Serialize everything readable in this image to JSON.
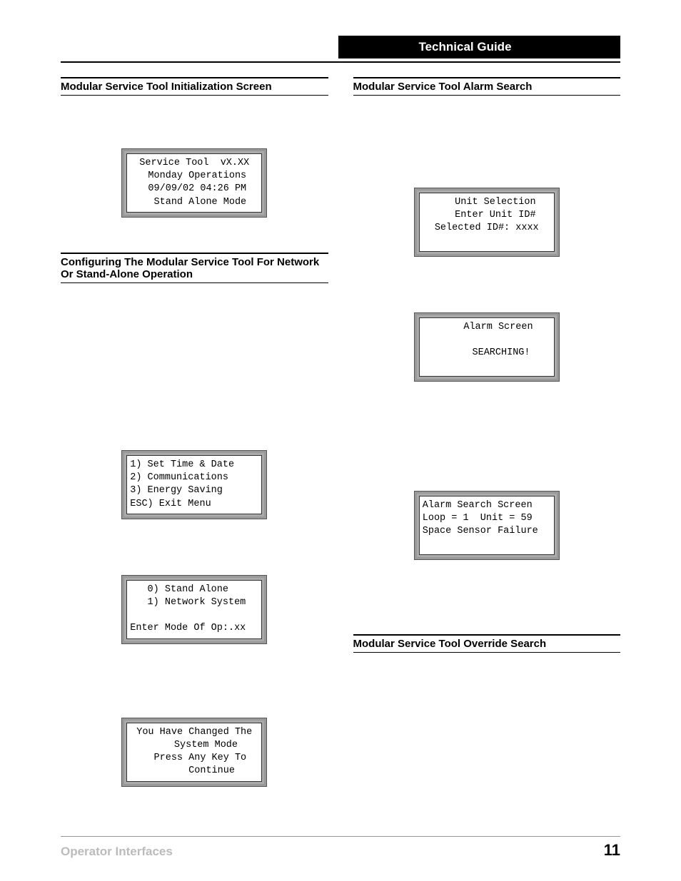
{
  "header": {
    "title": "Technical Guide"
  },
  "left": {
    "heading1": "Modular Service Tool Initialization Screen",
    "heading2": "Configuring The Modular Service Tool For Network Or Stand-Alone Operation",
    "lcd1": "Service Tool  vX.XX\n Monday Operations\n 09/09/02 04:26 PM\n  Stand Alone Mode",
    "lcd2": "1) Set Time & Date\n2) Communications\n3) Energy Saving\nESC) Exit Menu",
    "lcd3": "   0) Stand Alone\n   1) Network System\n\nEnter Mode Of Op:.xx",
    "lcd4": "You Have Changed The\n    System Mode\n  Press Any Key To\n      Continue"
  },
  "right": {
    "heading1": "Modular Service Tool Alarm Search",
    "heading2": "Modular Service Tool Override Search",
    "lcd1": "   Unit Selection\n   Enter Unit ID#\nSelected ID#: xxxx\n ",
    "lcd2": "    Alarm Screen\n\n     SEARCHING!\n ",
    "lcd3": "Alarm Search Screen\nLoop = 1  Unit = 59\nSpace Sensor Failure\n "
  },
  "footer": {
    "left": "Operator Interfaces",
    "right": "11"
  }
}
